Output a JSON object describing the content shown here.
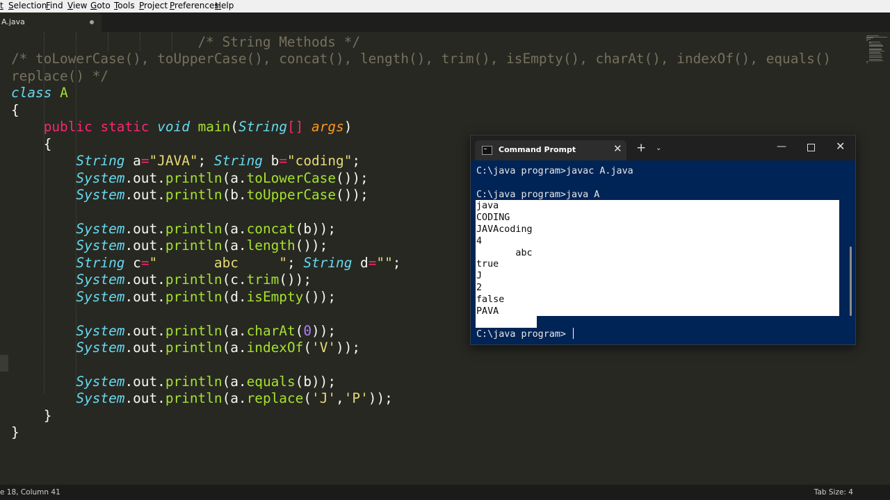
{
  "menu": [
    "t",
    "Selection",
    "Find",
    "View",
    "Goto",
    "Tools",
    "Project",
    "Preferences",
    "Help"
  ],
  "tab": {
    "filename": "A.java"
  },
  "code_lines": [
    [
      [
        "cm",
        "                       /* String Methods */"
      ]
    ],
    [
      [
        "cm",
        "/* toLowerCase(), toUpperCase(), concat(), length(), trim(), isEmpty(), charAt(), indexOf(), equals()"
      ]
    ],
    [
      [
        "cm",
        "replace() */"
      ]
    ],
    [
      [
        "ty",
        "class"
      ],
      [
        "",
        " "
      ],
      [
        "fn",
        "A"
      ]
    ],
    [
      [
        "",
        "{"
      ]
    ],
    [
      [
        "",
        "    "
      ],
      [
        "kw",
        "public"
      ],
      [
        "",
        " "
      ],
      [
        "kw",
        "static"
      ],
      [
        "",
        " "
      ],
      [
        "ty",
        "void"
      ],
      [
        "",
        " "
      ],
      [
        "fn",
        "main"
      ],
      [
        "",
        "("
      ],
      [
        "ty",
        "String"
      ],
      [
        "kw",
        "[]"
      ],
      [
        "",
        " "
      ],
      [
        "pm",
        "args"
      ],
      [
        "",
        ")"
      ]
    ],
    [
      [
        "",
        "    {"
      ]
    ],
    [
      [
        "",
        "        "
      ],
      [
        "ty",
        "String"
      ],
      [
        "",
        " a"
      ],
      [
        "kw",
        "="
      ],
      [
        "st",
        "\"JAVA\""
      ],
      [
        "",
        "; "
      ],
      [
        "ty",
        "String"
      ],
      [
        "",
        " b"
      ],
      [
        "kw",
        "="
      ],
      [
        "st",
        "\"coding\""
      ],
      [
        "",
        ";"
      ]
    ],
    [
      [
        "",
        "        "
      ],
      [
        "ty",
        "System"
      ],
      [
        "",
        ".out."
      ],
      [
        "fn",
        "println"
      ],
      [
        "",
        "(a."
      ],
      [
        "fn",
        "toLowerCase"
      ],
      [
        "",
        "());"
      ]
    ],
    [
      [
        "",
        "        "
      ],
      [
        "ty",
        "System"
      ],
      [
        "",
        ".out."
      ],
      [
        "fn",
        "println"
      ],
      [
        "",
        "(b."
      ],
      [
        "fn",
        "toUpperCase"
      ],
      [
        "",
        "());"
      ]
    ],
    [],
    [
      [
        "",
        "        "
      ],
      [
        "ty",
        "System"
      ],
      [
        "",
        ".out."
      ],
      [
        "fn",
        "println"
      ],
      [
        "",
        "(a."
      ],
      [
        "fn",
        "concat"
      ],
      [
        "",
        "(b));"
      ]
    ],
    [
      [
        "",
        "        "
      ],
      [
        "ty",
        "System"
      ],
      [
        "",
        ".out."
      ],
      [
        "fn",
        "println"
      ],
      [
        "",
        "(a."
      ],
      [
        "fn",
        "length"
      ],
      [
        "",
        "());"
      ]
    ],
    [
      [
        "",
        "        "
      ],
      [
        "ty",
        "String"
      ],
      [
        "",
        " c"
      ],
      [
        "kw",
        "="
      ],
      [
        "st",
        "\"       abc     \""
      ],
      [
        "",
        "; "
      ],
      [
        "ty",
        "String"
      ],
      [
        "",
        " d"
      ],
      [
        "kw",
        "="
      ],
      [
        "st",
        "\"\""
      ],
      [
        "",
        ";"
      ]
    ],
    [
      [
        "",
        "        "
      ],
      [
        "ty",
        "System"
      ],
      [
        "",
        ".out."
      ],
      [
        "fn",
        "println"
      ],
      [
        "",
        "(c."
      ],
      [
        "fn",
        "trim"
      ],
      [
        "",
        "());"
      ]
    ],
    [
      [
        "",
        "        "
      ],
      [
        "ty",
        "System"
      ],
      [
        "",
        ".out."
      ],
      [
        "fn",
        "println"
      ],
      [
        "",
        "(d."
      ],
      [
        "fn",
        "isEmpty"
      ],
      [
        "",
        "());"
      ]
    ],
    [],
    [
      [
        "",
        "        "
      ],
      [
        "ty",
        "System"
      ],
      [
        "",
        ".out."
      ],
      [
        "fn",
        "println"
      ],
      [
        "",
        "(a."
      ],
      [
        "fn",
        "charAt"
      ],
      [
        "",
        "("
      ],
      [
        "nm",
        "0"
      ],
      [
        "",
        "));"
      ]
    ],
    [
      [
        "",
        "        "
      ],
      [
        "ty",
        "System"
      ],
      [
        "",
        ".out."
      ],
      [
        "fn",
        "println"
      ],
      [
        "",
        "(a."
      ],
      [
        "fn",
        "indexOf"
      ],
      [
        "",
        "("
      ],
      [
        "st",
        "'V'"
      ],
      [
        "",
        "));"
      ]
    ],
    [],
    [
      [
        "",
        "        "
      ],
      [
        "ty",
        "System"
      ],
      [
        "",
        ".out."
      ],
      [
        "fn",
        "println"
      ],
      [
        "",
        "(a."
      ],
      [
        "fn",
        "equals"
      ],
      [
        "",
        "(b));"
      ]
    ],
    [
      [
        "",
        "        "
      ],
      [
        "ty",
        "System"
      ],
      [
        "",
        ".out."
      ],
      [
        "fn",
        "println"
      ],
      [
        "",
        "(a."
      ],
      [
        "fn",
        "replace"
      ],
      [
        "",
        "("
      ],
      [
        "st",
        "'J'"
      ],
      [
        "",
        ","
      ],
      [
        "st",
        "'P'"
      ],
      [
        "",
        "));"
      ]
    ],
    [
      [
        "",
        "    }"
      ]
    ],
    [
      [
        "",
        "}"
      ]
    ]
  ],
  "terminal": {
    "tab_title": "Command Prompt",
    "close_glyph": "✕",
    "new_tab_glyph": "+",
    "dropdown_glyph": "⌄",
    "minimize_glyph": "—",
    "close_window_glyph": "✕",
    "lines": [
      "C:\\java program>javac A.java",
      "",
      "C:\\java program>java A",
      "java",
      "CODING",
      "JAVAcoding",
      "4",
      "       abc",
      "true",
      "J",
      "2",
      "false",
      "PAVA",
      "",
      "C:\\java program>"
    ]
  },
  "status": {
    "position": "e 18, Column 41",
    "tab_size": "Tab Size: 4"
  }
}
